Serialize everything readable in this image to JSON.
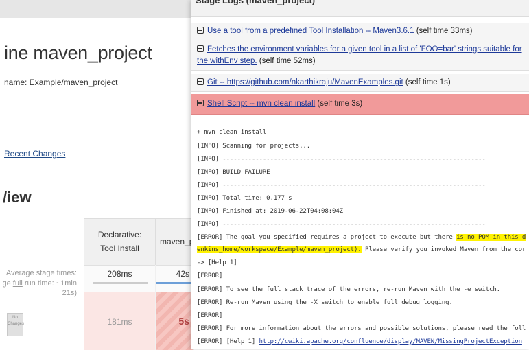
{
  "background": {
    "title": "ine maven_project",
    "full_name": "name: Example/maven_project",
    "recent_changes_link": "Recent Changes",
    "stage_view_heading": "/iew",
    "columns": [
      {
        "label": "Declarative: Tool Install"
      },
      {
        "label": "maven_pr"
      }
    ],
    "avg_label_line1": "Average stage times:",
    "avg_label_line2_prefix": "ge ",
    "avg_label_line2_link": "full",
    "avg_label_line2_suffix": " run time: ~1min",
    "avg_label_line3": "21s)",
    "avg_values": [
      "208ms",
      "42s"
    ],
    "run_values": [
      "181ms",
      "5s"
    ],
    "changes_badge": "No Changes"
  },
  "overlay": {
    "title": "Stage Logs (maven_project)",
    "steps": [
      {
        "link": "Use a tool from a predefined Tool Installation -- Maven3.6.1",
        "suffix": " (self time 33ms)",
        "status": "ok"
      },
      {
        "link": "Fetches the environment variables for a given tool in a list of 'FOO=bar' strings suitable for the withEnv step.",
        "suffix": " (self time 52ms)",
        "status": "ok"
      },
      {
        "link": "Git -- https://github.com/nkarthikraju/MavenExamples.git",
        "suffix": " (self time 1s)",
        "status": "ok"
      },
      {
        "link": "Shell Script -- mvn clean install",
        "suffix": " (self time 3s)",
        "status": "failed"
      }
    ],
    "log": {
      "l1": "+ mvn clean install",
      "l2": "[INFO] Scanning for projects...",
      "l3": "[INFO] ------------------------------------------------------------------------",
      "l4": "[INFO] BUILD FAILURE",
      "l5": "[INFO] ------------------------------------------------------------------------",
      "l6": "[INFO] Total time:  0.177 s",
      "l7": "[INFO] Finished at: 2019-06-22T04:08:04Z",
      "l8": "[INFO] ------------------------------------------------------------------------",
      "l9_prefix": "[ERROR] The goal you specified requires a project to execute but there ",
      "l9_highlight": "is no POM in this directory (/var/j",
      "l10_highlight": "enkins_home/workspace/Example/maven_project).",
      "l10_suffix": " Please verify you invoked Maven from the correct directory.",
      "l11": "-> [Help 1]",
      "l12": "[ERROR]",
      "l13": "[ERROR] To see the full stack trace of the errors, re-run Maven with the -e switch.",
      "l14": "[ERROR] Re-run Maven using the -X switch to enable full debug logging.",
      "l15": "[ERROR]",
      "l16": "[ERROR] For more information about the errors and possible solutions, please read the following articles:",
      "l17_prefix": "[ERROR] [Help 1] ",
      "l17_link": "http://cwiki.apache.org/confluence/display/MAVEN/MissingProjectException"
    }
  },
  "colors": {
    "failed_step": "#f19a9a",
    "highlight": "#fff200",
    "link": "#1e3a99",
    "failed_stage_cell": "#f7c7c2"
  }
}
